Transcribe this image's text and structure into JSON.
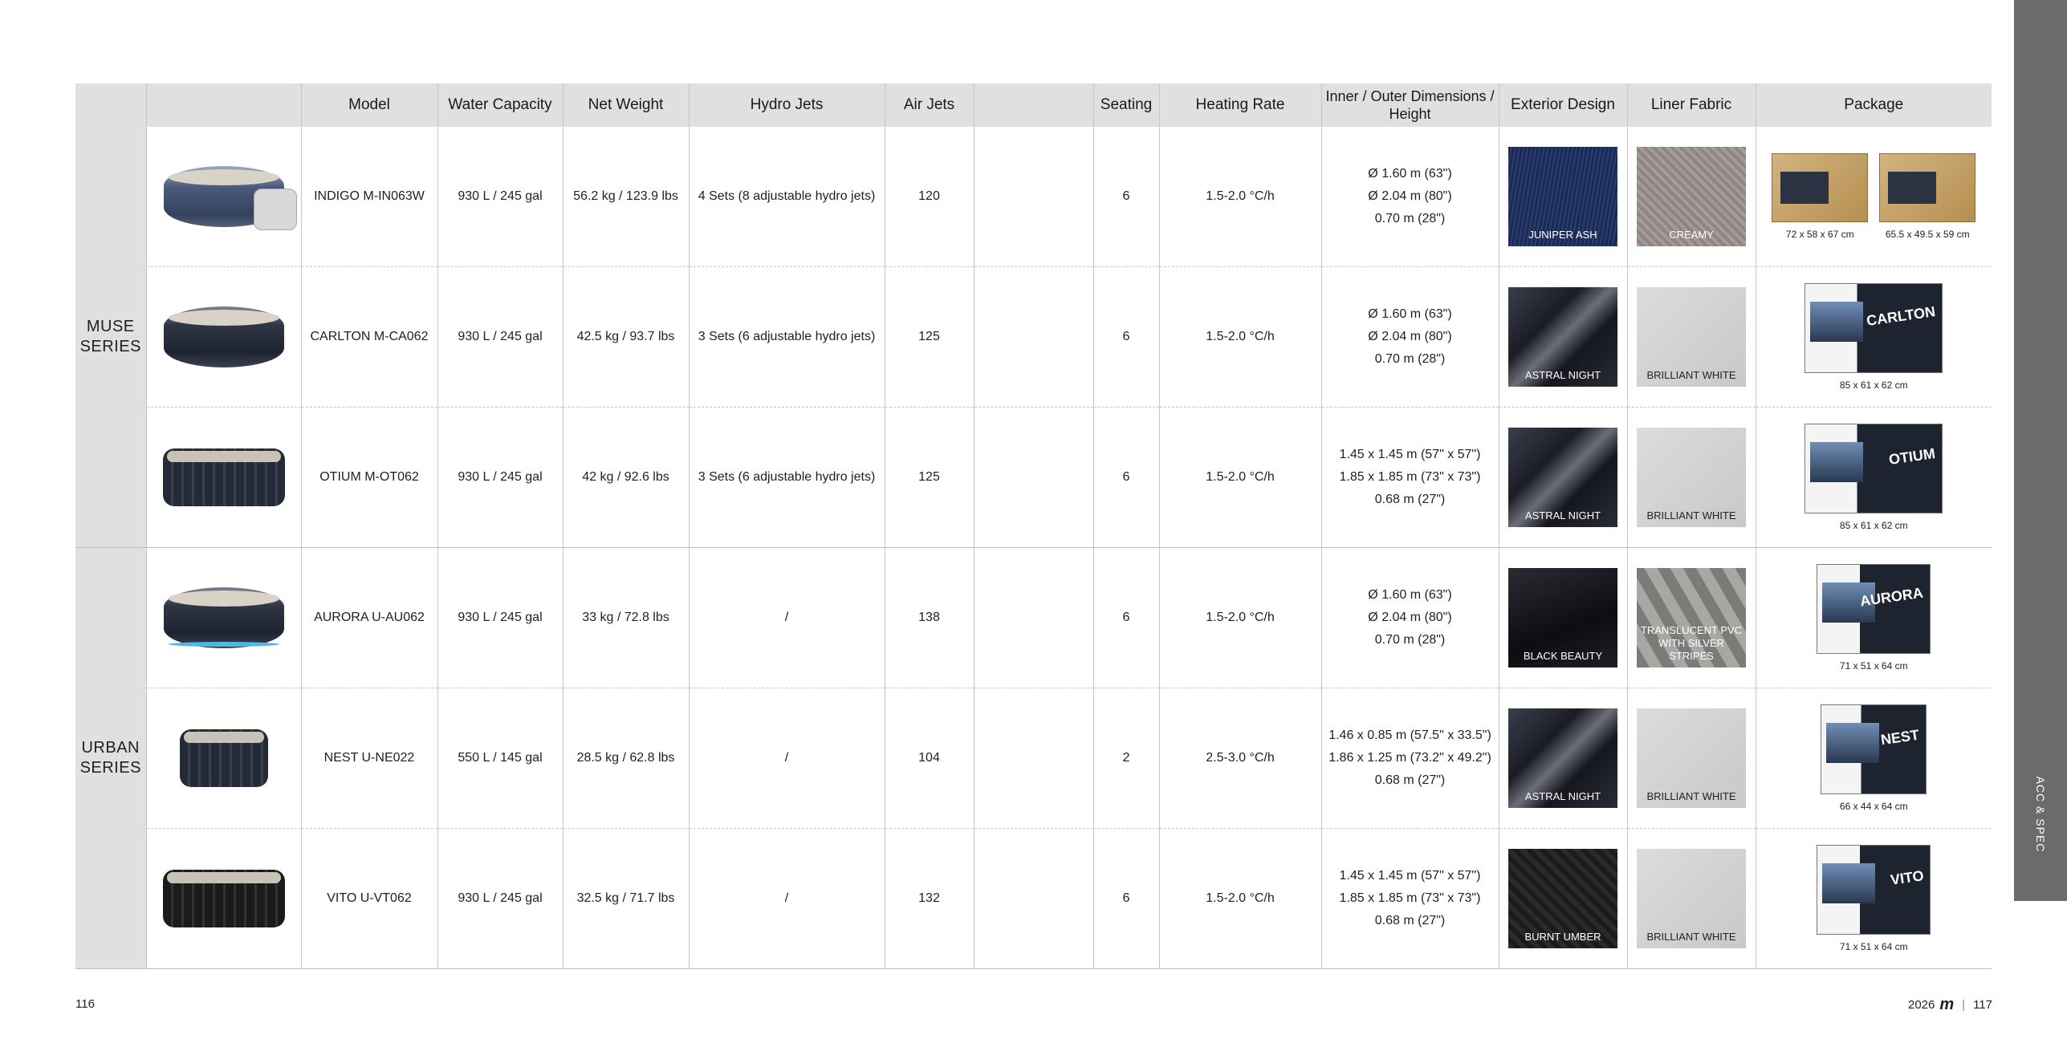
{
  "headers": {
    "model": "Model",
    "water_capacity": "Water Capacity",
    "net_weight": "Net Weight",
    "hydro_jets": "Hydro Jets",
    "air_jets": "Air Jets",
    "seating": "Seating",
    "heating_rate": "Heating Rate",
    "dimensions": "Inner / Outer Dimensions / Height",
    "exterior_design": "Exterior Design",
    "liner_fabric": "Liner Fabric",
    "package": "Package"
  },
  "series": [
    {
      "name": "MUSE SERIES"
    },
    {
      "name": "URBAN SERIES"
    }
  ],
  "rows": [
    {
      "model": "INDIGO M-IN063W",
      "water": "930 L / 245 gal",
      "weight": "56.2 kg / 123.9 lbs",
      "hydro": "4 Sets (8 adjustable hydro jets)",
      "air": "120",
      "seating": "6",
      "heating": "1.5-2.0 °C/h",
      "dim1": "Ø 1.60 m (63\")",
      "dim2": "Ø 2.04 m (80\")",
      "dim3": "0.70 m (28\")",
      "exterior": "JUNIPER ASH",
      "liner": "CREAMY",
      "package_dims": [
        "72 x 58 x 67 cm",
        "65.5 x 49.5 x 59 cm"
      ]
    },
    {
      "model": "CARLTON  M-CA062",
      "water": "930 L / 245 gal",
      "weight": "42.5 kg / 93.7 lbs",
      "hydro": "3 Sets (6 adjustable hydro jets)",
      "air": "125",
      "seating": "6",
      "heating": "1.5-2.0 °C/h",
      "dim1": "Ø 1.60 m (63\")",
      "dim2": "Ø 2.04 m (80\")",
      "dim3": "0.70 m (28\")",
      "exterior": "ASTRAL NIGHT",
      "liner": "BRILLIANT WHITE",
      "box_name": "CARLTON",
      "package_dim": "85 x 61 x 62 cm"
    },
    {
      "model": "OTIUM  M-OT062",
      "water": "930 L / 245 gal",
      "weight": "42 kg / 92.6 lbs",
      "hydro": "3 Sets (6 adjustable hydro jets)",
      "air": "125",
      "seating": "6",
      "heating": "1.5-2.0 °C/h",
      "dim1": "1.45 x 1.45 m (57\" x 57\")",
      "dim2": "1.85 x 1.85 m (73\" x 73\")",
      "dim3": "0.68 m (27\")",
      "exterior": "ASTRAL NIGHT",
      "liner": "BRILLIANT WHITE",
      "box_name": "OTIUM",
      "package_dim": "85 x 61 x 62 cm"
    },
    {
      "model": "AURORA  U-AU062",
      "water": "930 L / 245 gal",
      "weight": "33 kg / 72.8 lbs",
      "hydro": "/",
      "air": "138",
      "seating": "6",
      "heating": "1.5-2.0 °C/h",
      "dim1": "Ø 1.60 m (63\")",
      "dim2": "Ø 2.04 m (80\")",
      "dim3": "0.70 m (28\")",
      "exterior": "BLACK BEAUTY",
      "liner_line1": "TRANSLUCENT PVC",
      "liner_line2": "WITH SILVER STRIPES",
      "box_name": "AURORA",
      "package_dim": "71 x 51 x 64 cm"
    },
    {
      "model": "NEST  U-NE022",
      "water": "550 L / 145 gal",
      "weight": "28.5 kg / 62.8 lbs",
      "hydro": "/",
      "air": "104",
      "seating": "2",
      "heating": "2.5-3.0 °C/h",
      "dim1": "1.46 x 0.85 m (57.5\" x 33.5\")",
      "dim2": "1.86 x 1.25 m (73.2\" x 49.2\")",
      "dim3": "0.68 m (27\")",
      "exterior": "ASTRAL NIGHT",
      "liner": "BRILLIANT WHITE",
      "box_name": "NEST",
      "package_dim": "66 x 44 x 64 cm"
    },
    {
      "model": "VITO  U-VT062",
      "water": "930 L / 245 gal",
      "weight": "32.5 kg / 71.7 lbs",
      "hydro": "/",
      "air": "132",
      "seating": "6",
      "heating": "1.5-2.0 °C/h",
      "dim1": "1.45 x 1.45 m (57\" x 57\")",
      "dim2": "1.85 x 1.85 m (73\" x 73\")",
      "dim3": "0.68 m (27\")",
      "exterior": "BURNT UMBER",
      "liner": "BRILLIANT WHITE",
      "box_name": "VITO",
      "package_dim": "71 x 51 x 64 cm"
    }
  ],
  "side_tab": "ACC & SPEC",
  "footer": {
    "left_page": "116",
    "year": "2026",
    "brand": "m",
    "right_page": "117"
  }
}
